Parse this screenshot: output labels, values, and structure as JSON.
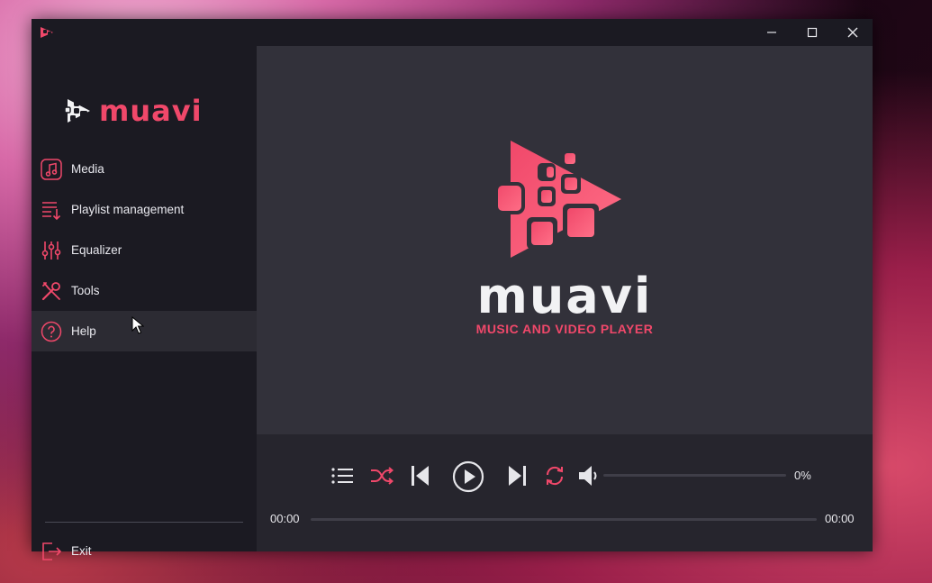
{
  "app": {
    "name": "muavi",
    "tagline": "MUSIC AND VIDEO PLAYER"
  },
  "colors": {
    "accent": "#f0486a",
    "sidebar_bg": "#1b1a22",
    "main_bg": "#32313a",
    "controls_bg": "#26252d"
  },
  "window_controls": {
    "minimize_icon": "minimize-icon",
    "maximize_icon": "maximize-icon",
    "close_icon": "close-icon"
  },
  "sidebar": {
    "items": [
      {
        "label": "Media",
        "icon": "music-note-icon",
        "active": false
      },
      {
        "label": "Playlist management",
        "icon": "playlist-icon",
        "active": false
      },
      {
        "label": "Equalizer",
        "icon": "equalizer-icon",
        "active": false
      },
      {
        "label": "Tools",
        "icon": "tools-icon",
        "active": false
      },
      {
        "label": "Help",
        "icon": "help-icon",
        "active": true
      }
    ],
    "exit_label": "Exit"
  },
  "player": {
    "volume_percent": "0%",
    "volume_level": 0,
    "time_current": "00:00",
    "time_total": "00:00",
    "progress": 0
  }
}
